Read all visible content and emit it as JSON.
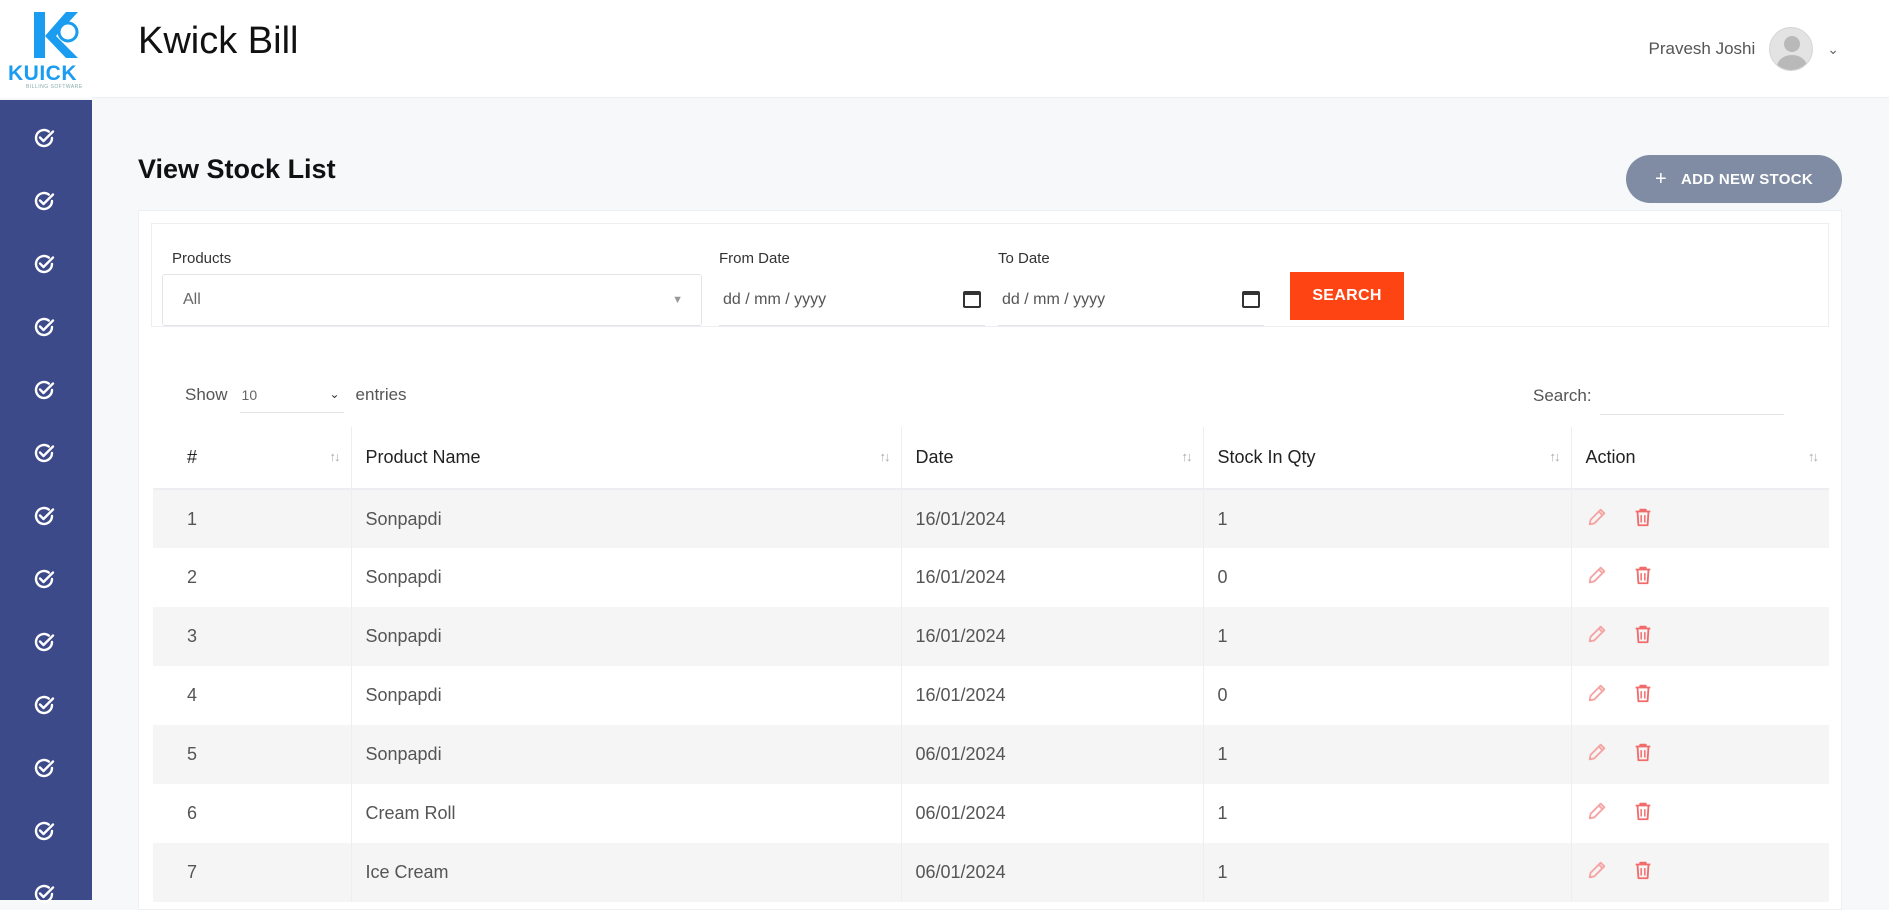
{
  "app": {
    "title": "Kwick Bill",
    "logo_text": "KUICK",
    "logo_tagline": "BILLING SOFTWARE"
  },
  "user": {
    "name": "Pravesh Joshi"
  },
  "sidebar": {
    "item_count": 13,
    "icon": "check-circle-icon"
  },
  "page": {
    "title": "View Stock List",
    "add_button_label": "ADD NEW STOCK"
  },
  "filters": {
    "products_label": "Products",
    "products_value": "All",
    "from_date_label": "From Date",
    "from_date_placeholder": "dd / mm / yyyy",
    "to_date_label": "To Date",
    "to_date_placeholder": "dd / mm / yyyy",
    "search_button": "SEARCH"
  },
  "table_controls": {
    "show_label": "Show",
    "entries_value": "10",
    "entries_label": "entries",
    "search_label": "Search:"
  },
  "table": {
    "columns": [
      "#",
      "Product Name",
      "Date",
      "Stock In Qty",
      "Action"
    ],
    "rows": [
      {
        "no": "1",
        "product": "Sonpapdi",
        "date": "16/01/2024",
        "qty": "1"
      },
      {
        "no": "2",
        "product": "Sonpapdi",
        "date": "16/01/2024",
        "qty": "0"
      },
      {
        "no": "3",
        "product": "Sonpapdi",
        "date": "16/01/2024",
        "qty": "1"
      },
      {
        "no": "4",
        "product": "Sonpapdi",
        "date": "16/01/2024",
        "qty": "0"
      },
      {
        "no": "5",
        "product": "Sonpapdi",
        "date": "06/01/2024",
        "qty": "1"
      },
      {
        "no": "6",
        "product": "Cream Roll",
        "date": "06/01/2024",
        "qty": "1"
      },
      {
        "no": "7",
        "product": "Ice Cream",
        "date": "06/01/2024",
        "qty": "1"
      }
    ]
  },
  "colors": {
    "sidebar": "#3d4a8a",
    "accent": "#ff4414",
    "add_button": "#7f8ca3",
    "action_icon": "#f26b6b"
  }
}
